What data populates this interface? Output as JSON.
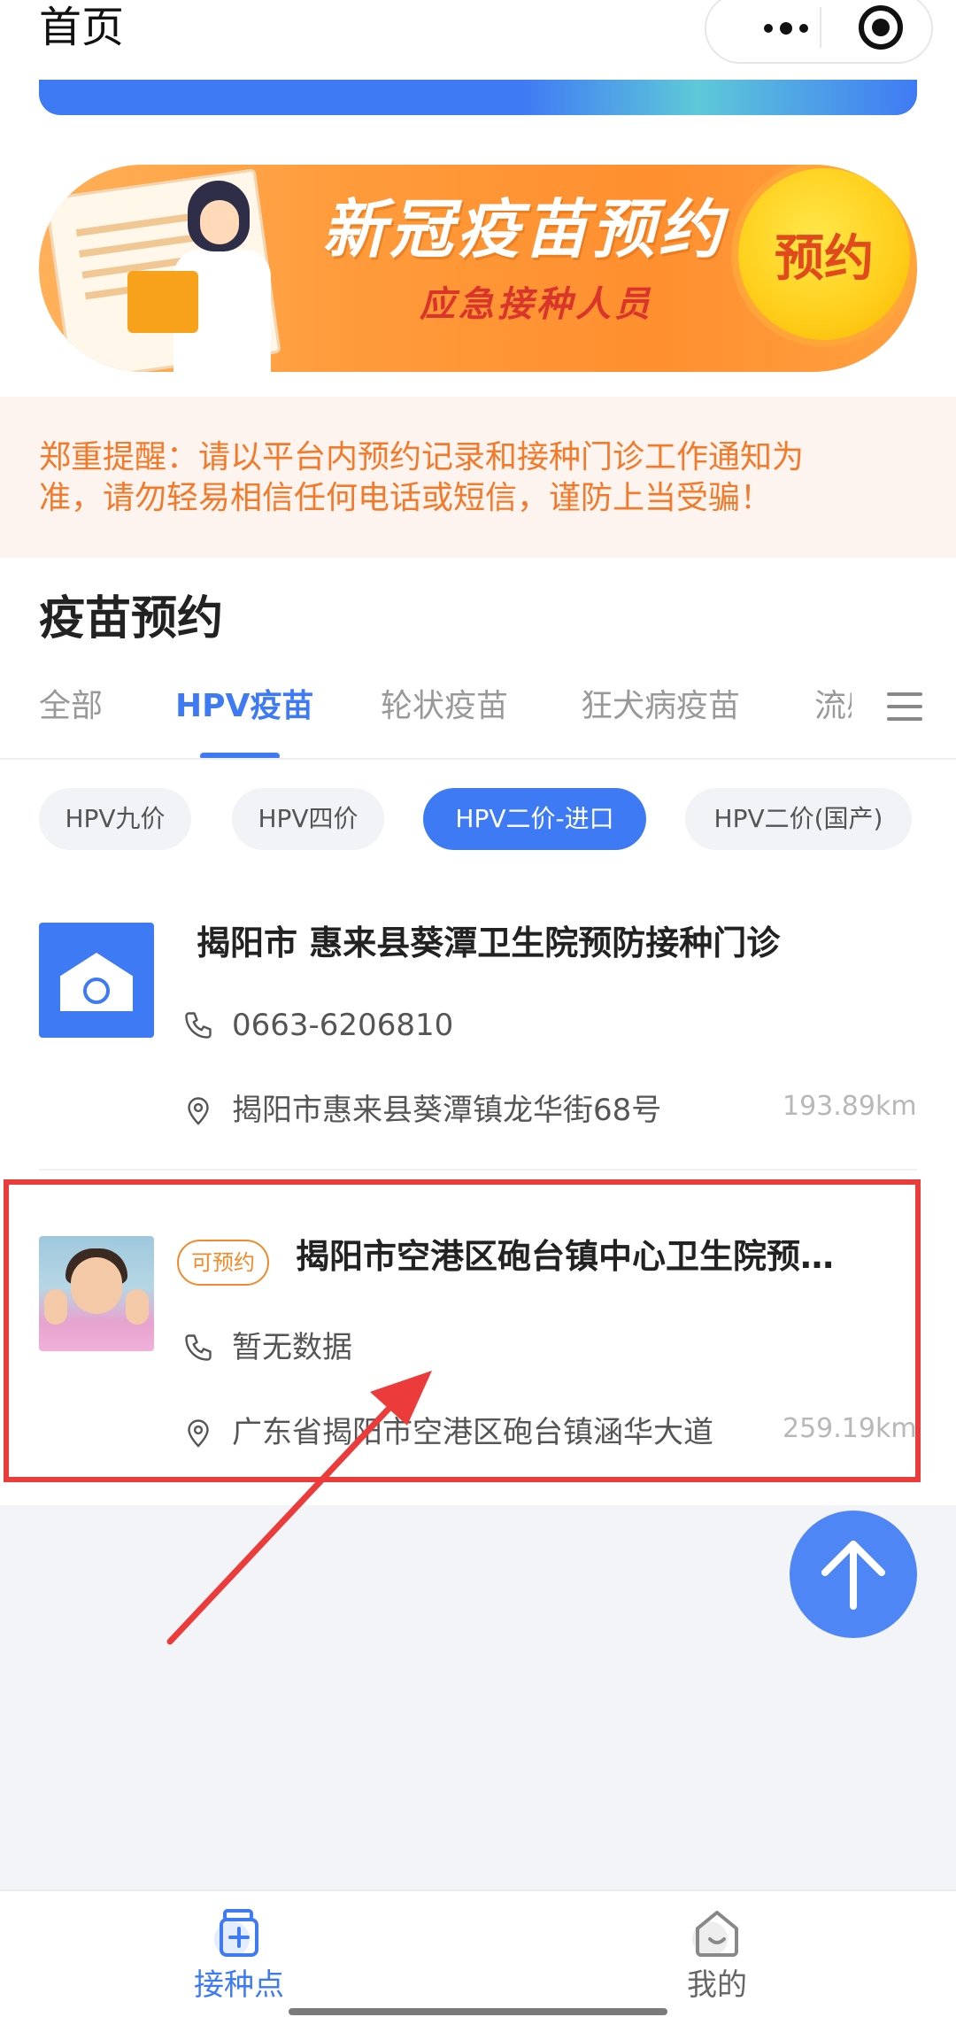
{
  "header": {
    "title": "首页"
  },
  "banner": {
    "title": "新冠疫苗预约",
    "subtitle": "应急接种人员",
    "button_label": "预约"
  },
  "notice": {
    "line1": "郑重提醒：请以平台内预约记录和接种门诊工作通知为",
    "line2": "准，请勿轻易相信任何电话或短信，谨防上当受骗！"
  },
  "section": {
    "title": "疫苗预约"
  },
  "tabs": [
    {
      "label": "全部",
      "active": false
    },
    {
      "label": "HPV疫苗",
      "active": true
    },
    {
      "label": "轮状疫苗",
      "active": false
    },
    {
      "label": "狂犬病疫苗",
      "active": false
    },
    {
      "label": "流感",
      "active": false
    }
  ],
  "chips": [
    {
      "label": "HPV九价",
      "active": false
    },
    {
      "label": "HPV四价",
      "active": false
    },
    {
      "label": "HPV二价-进口",
      "active": true
    },
    {
      "label": "HPV二价(国产)",
      "active": false
    }
  ],
  "clinics": [
    {
      "name": "揭阳市 惠来县葵潭卫生院预防接种门诊",
      "phone": "0663-6206810",
      "address": "揭阳市惠来县葵潭镇龙华街68号",
      "distance": "193.89km",
      "badge": "",
      "thumb": "clinic-logo"
    },
    {
      "name": "揭阳市空港区砲台镇中心卫生院预…",
      "phone": "暂无数据",
      "address": "广东省揭阳市空港区砲台镇涵华大道",
      "distance": "259.19km",
      "badge": "可预约",
      "thumb": "child-photo"
    }
  ],
  "bottom_nav": [
    {
      "label": "接种点",
      "icon": "medicine-box-icon",
      "active": true
    },
    {
      "label": "我的",
      "icon": "profile-home-icon",
      "active": false
    }
  ],
  "colors": {
    "accent": "#3f7af5",
    "warning": "#f27a2a",
    "highlight": "#ec3b3b"
  }
}
